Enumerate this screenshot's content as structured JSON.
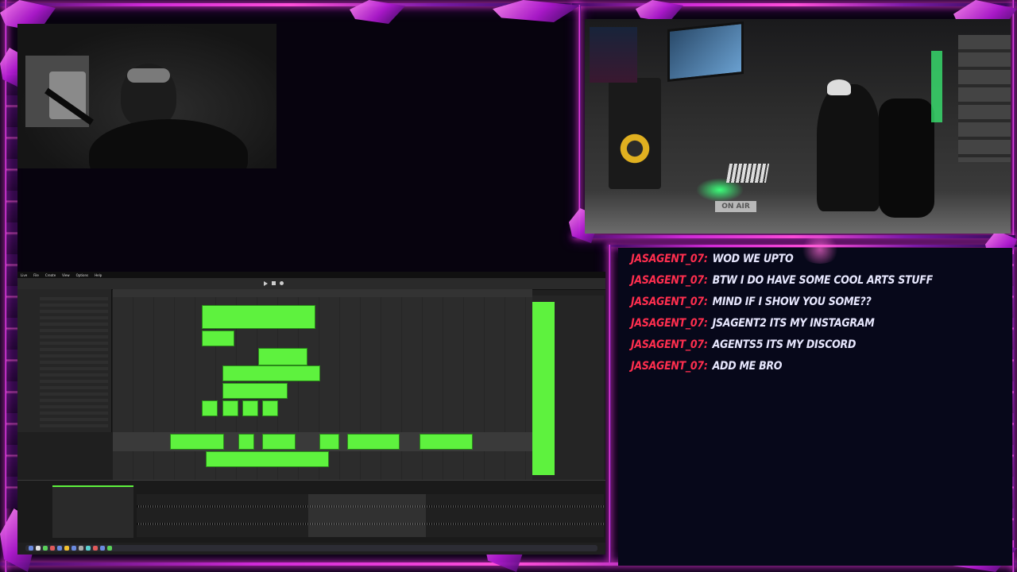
{
  "overlay": {
    "accent_pink": "#ff3fe0",
    "accent_purple": "#a01ad0"
  },
  "studio_cam": {
    "sign_text": "ON AIR"
  },
  "chat": {
    "username_color": "#ff2e4e",
    "message_color": "#e8e8ff",
    "messages": [
      {
        "user": "JASAGENT_07:",
        "text": "WOD WE UPTO"
      },
      {
        "user": "JASAGENT_07:",
        "text": "BTW I DO HAVE SOME COOL ARTS STUFF"
      },
      {
        "user": "JASAGENT_07:",
        "text": "MIND IF I SHOW YOU SOME??"
      },
      {
        "user": "JASAGENT_07:",
        "text": "JSAGENT2 ITS MY INSTAGRAM"
      },
      {
        "user": "JASAGENT_07:",
        "text": "AGENTS5 ITS MY DISCORD"
      },
      {
        "user": "JASAGENT_07:",
        "text": "ADD ME BRO"
      }
    ]
  },
  "daw": {
    "menu": [
      "Live",
      "File",
      "Create",
      "View",
      "Options",
      "Help"
    ],
    "clip_color": "#5ef23e"
  }
}
